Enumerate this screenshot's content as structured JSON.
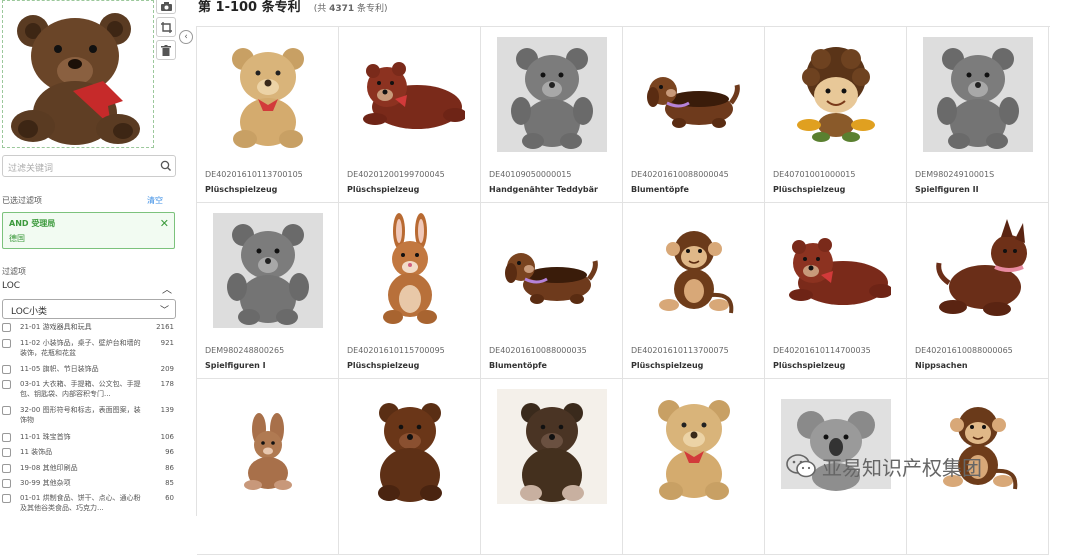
{
  "sidebar": {
    "search_placeholder": "过滤关键词",
    "selected_filters_label": "已选过滤项",
    "clear_label": "清空",
    "chip_line1": "AND 受理局",
    "chip_line2": "德国",
    "filters_label": "过滤项",
    "loc_label": "LOC",
    "select_value": "LOC小类",
    "items": [
      {
        "label": "21-01 游戏器具和玩具",
        "count": "2161"
      },
      {
        "label": "11-02 小装饰品，桌子、壁炉台和墙的装饰，花瓶和花盆",
        "count": "921"
      },
      {
        "label": "11-05 旗帜、节日装饰品",
        "count": "209"
      },
      {
        "label": "03-01 大衣箱、手提箱、公文包、手提包、钥匙袋、内部容积专门...",
        "count": "178"
      },
      {
        "label": "32-00 图形符号和标志，表面图案，装饰物",
        "count": "139"
      },
      {
        "label": "11-01 珠宝首饰",
        "count": "106"
      },
      {
        "label": "11 装饰品",
        "count": "96"
      },
      {
        "label": "19-08 其他印刷品",
        "count": "86"
      },
      {
        "label": "30-99 其他杂项",
        "count": "85"
      },
      {
        "label": "01-01 烘制食品、饼干、点心、通心粉及其他谷类食品、巧克力...",
        "count": "60"
      }
    ]
  },
  "header": {
    "title": "第 1-100 条专利",
    "subtitle_pre": "(共 ",
    "subtitle_count": "4371",
    "subtitle_post": " 条专利)"
  },
  "results": [
    {
      "code": "DE40201610113700105",
      "name": "Plüschspielzeug",
      "icon": "teddy-bear-light"
    },
    {
      "code": "DE40201200199700045",
      "name": "Plüschspielzeug",
      "icon": "lying-bear"
    },
    {
      "code": "DE40109050000015",
      "name": "Handgenähter Teddybär",
      "icon": "teddy-bear-gray"
    },
    {
      "code": "DE40201610088000045",
      "name": "Blumentöpfe",
      "icon": "dog-planter"
    },
    {
      "code": "DE40701001000015",
      "name": "Plüschspielzeug",
      "icon": "curly-doll"
    },
    {
      "code": "DEM98024910001S",
      "name": "Spielfiguren II",
      "icon": "teddy-bear-gray"
    },
    {
      "code": "DEM980248800265",
      "name": "Spielfiguren I",
      "icon": "teddy-bear-gray"
    },
    {
      "code": "DE40201610115700095",
      "name": "Plüschspielzeug",
      "icon": "bunny"
    },
    {
      "code": "DE40201610088000035",
      "name": "Blumentöpfe",
      "icon": "dog-planter"
    },
    {
      "code": "DE40201610113700075",
      "name": "Plüschspielzeug",
      "icon": "monkey"
    },
    {
      "code": "DE40201610114700035",
      "name": "Plüschspielzeug",
      "icon": "lying-bear"
    },
    {
      "code": "DE40201610088000065",
      "name": "Nippsachen",
      "icon": "dog-figure"
    },
    {
      "code": "",
      "name": "",
      "icon": "bunny-small"
    },
    {
      "code": "",
      "name": "",
      "icon": "brown-bear"
    },
    {
      "code": "",
      "name": "",
      "icon": "dark-bear"
    },
    {
      "code": "",
      "name": "",
      "icon": "teddy-bear-light"
    },
    {
      "code": "",
      "name": "",
      "icon": "koala"
    },
    {
      "code": "",
      "name": "",
      "icon": "monkey"
    }
  ],
  "watermark": "亚易知识产权集团"
}
